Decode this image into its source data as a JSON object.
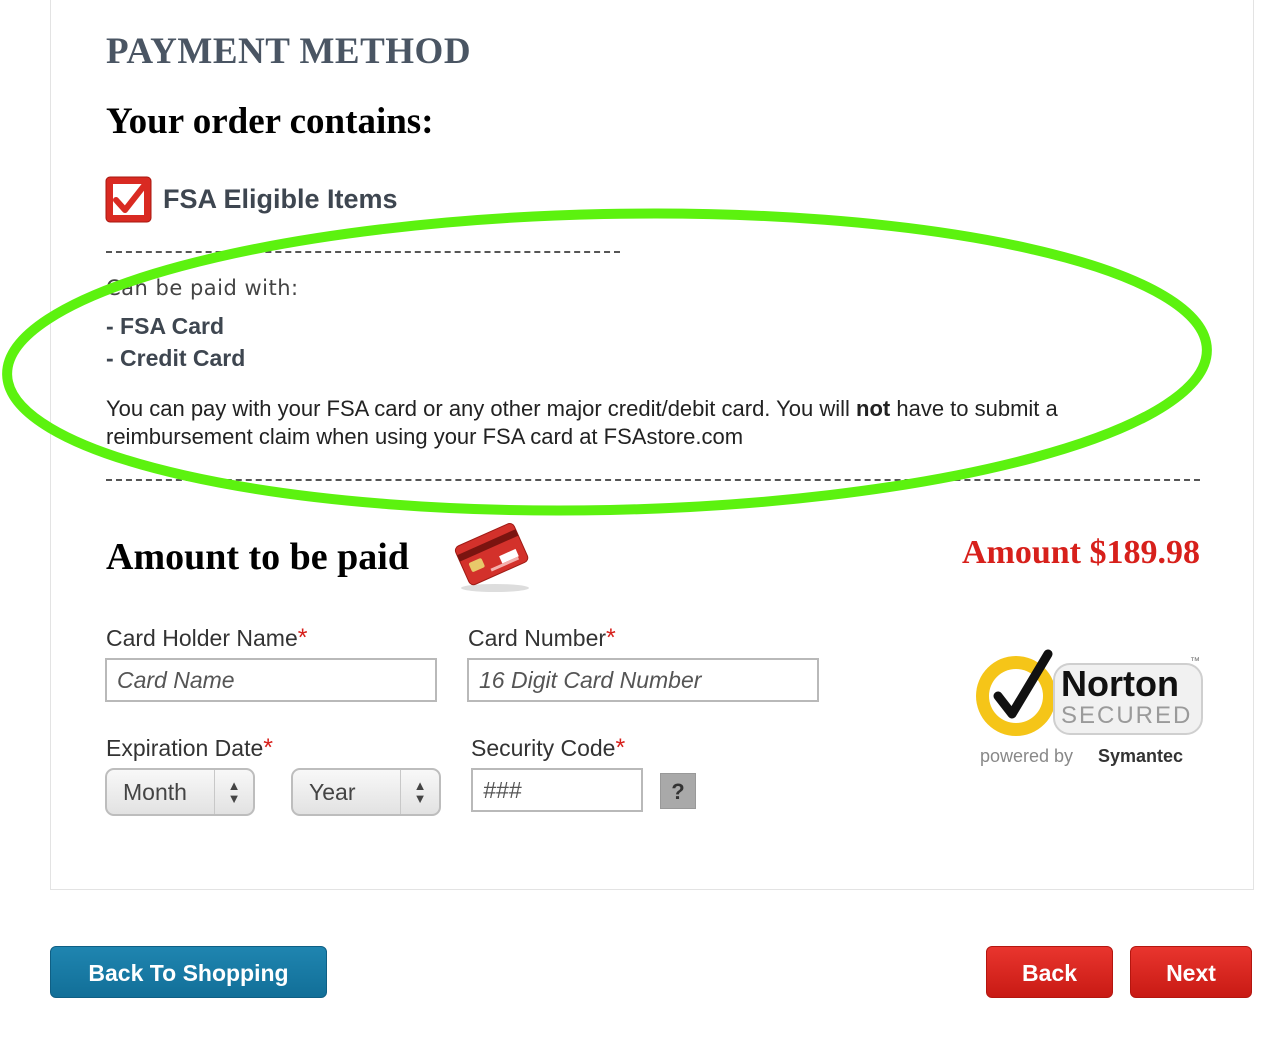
{
  "header": {
    "title": "PAYMENT METHOD",
    "order_heading": "Your order contains:"
  },
  "order": {
    "fsa_label": "FSA Eligible Items",
    "paid_with_label": "Can be paid with:",
    "methods": [
      "- FSA Card",
      "- Credit Card"
    ],
    "note_before": "You can pay with your FSA card or any other major credit/debit card. You will ",
    "note_bold": "not",
    "note_after": " have to submit a reimbursement claim when using your FSA card at FSAstore.com"
  },
  "payment": {
    "heading": "Amount to be paid",
    "amount": "Amount $189.98",
    "required_mark": "*",
    "card_holder_label": "Card Holder Name",
    "card_holder_placeholder": "Card Name",
    "card_number_label": "Card Number",
    "card_number_placeholder": "16 Digit Card Number",
    "expiration_label": "Expiration Date",
    "month_value": "Month",
    "year_value": "Year",
    "security_label": "Security Code",
    "security_placeholder": "###",
    "help_label": "?"
  },
  "norton": {
    "brand": "Norton",
    "secured": "SECURED",
    "powered_by": "powered by",
    "company": "Symantec",
    "tm": "™"
  },
  "buttons": {
    "back_to_shopping": "Back To Shopping",
    "back": "Back",
    "next": "Next"
  },
  "colors": {
    "highlight": "#5cf20f",
    "accent_red": "#d7201b",
    "shop_blue": "#1a7ba6"
  }
}
